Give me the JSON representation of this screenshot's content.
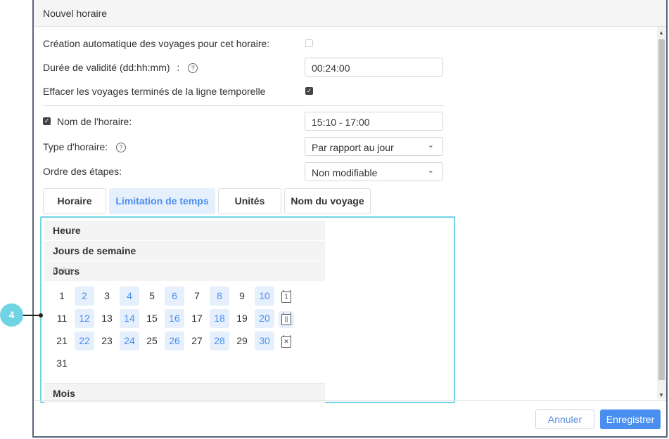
{
  "dialog": {
    "title": "Nouvel horaire",
    "auto_create_label": "Création automatique des voyages pour cet horaire:",
    "validity_label": "Durée de validité (dd:hh:mm)",
    "validity_colon": ":",
    "validity_value": "00:24:00",
    "erase_label": "Effacer les voyages terminés de la ligne temporelle",
    "schedule_name_label": "Nom de l'horaire:",
    "schedule_name_value": "15:10 - 17:00",
    "schedule_type_label": "Type d'horaire:",
    "schedule_type_value": "Par rapport au jour",
    "steps_order_label": "Ordre des étapes:",
    "steps_order_value": "Non modifiable",
    "help_glyph": "?",
    "check_glyph": "✓",
    "chevron_glyph": "⌄",
    "scroll_up_glyph": "▲",
    "scroll_down_glyph": "▼"
  },
  "tabs": [
    {
      "label": "Horaire",
      "active": false
    },
    {
      "label": "Limitation de temps",
      "active": true
    },
    {
      "label": "Unités",
      "active": false
    },
    {
      "label": "Nom du voyage",
      "active": false
    }
  ],
  "panel": {
    "section_hour": "Heure",
    "section_weekdays": "Jours de semaine",
    "section_days": "Jours",
    "pairs_label": "Pairs",
    "section_months": "Mois",
    "icon_single": "1",
    "icon_even": "||",
    "icon_clear": "✕",
    "days": [
      [
        "1",
        "2",
        "3",
        "4",
        "5",
        "6",
        "7",
        "8",
        "9",
        "10"
      ],
      [
        "11",
        "12",
        "13",
        "14",
        "15",
        "16",
        "17",
        "18",
        "19",
        "20"
      ],
      [
        "21",
        "22",
        "23",
        "24",
        "25",
        "26",
        "27",
        "28",
        "29",
        "30"
      ],
      [
        "31"
      ]
    ]
  },
  "footer": {
    "cancel_label": "Annuler",
    "save_label": "Enregistrer"
  },
  "callout": {
    "number": "4"
  },
  "colors": {
    "accent": "#4a8ef0",
    "selected_bg": "#e6effc",
    "highlight_border": "#6fd4e4"
  }
}
